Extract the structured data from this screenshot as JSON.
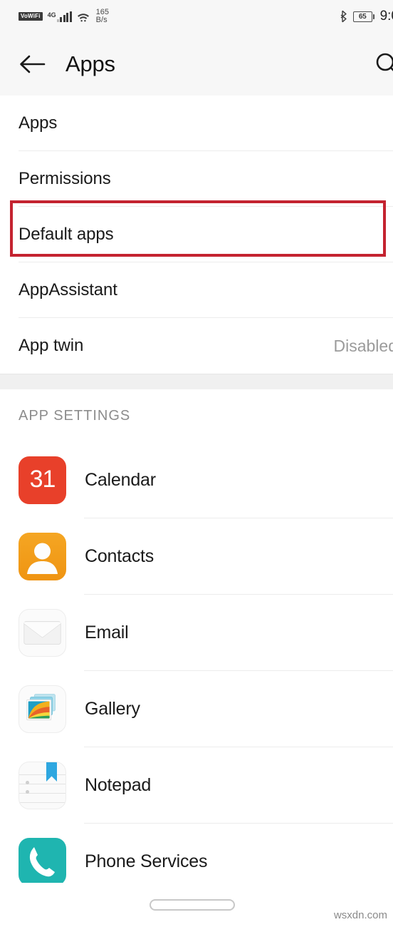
{
  "status_bar": {
    "volte_label": "VoWiFi",
    "network_type": "4G",
    "signal_icon": "signal-bars-icon",
    "wifi_icon": "wifi-icon",
    "data_speed": "165",
    "data_speed_unit": "B/s",
    "bluetooth_icon": "bluetooth-icon",
    "battery_level": "65",
    "clock": "9:0"
  },
  "header": {
    "back_icon": "back-arrow-icon",
    "title": "Apps",
    "search_icon": "search-icon"
  },
  "settings_rows": [
    {
      "label": "Apps",
      "value": ""
    },
    {
      "label": "Permissions",
      "value": ""
    },
    {
      "label": "Default apps",
      "value": ""
    },
    {
      "label": "AppAssistant",
      "value": ""
    },
    {
      "label": "App twin",
      "value": "Disabled"
    }
  ],
  "highlight": {
    "target_label": "Default apps",
    "color": "#c42330"
  },
  "app_settings": {
    "section_title": "APP SETTINGS",
    "apps": [
      {
        "name": "Calendar",
        "icon": "calendar-icon",
        "icon_text": "31",
        "color": "#e8402a"
      },
      {
        "name": "Contacts",
        "icon": "contacts-icon",
        "color": "#f5a623"
      },
      {
        "name": "Email",
        "icon": "email-icon",
        "color": "#fbfbfb"
      },
      {
        "name": "Gallery",
        "icon": "gallery-icon",
        "color": "#fbfbfb"
      },
      {
        "name": "Notepad",
        "icon": "notepad-icon",
        "color": "#2ea7e0"
      },
      {
        "name": "Phone Services",
        "icon": "phone-icon",
        "color": "#1fb5b0"
      }
    ]
  },
  "nav_bar": {
    "gesture_pill": "gesture-pill"
  },
  "watermark": "wsxdn.com"
}
